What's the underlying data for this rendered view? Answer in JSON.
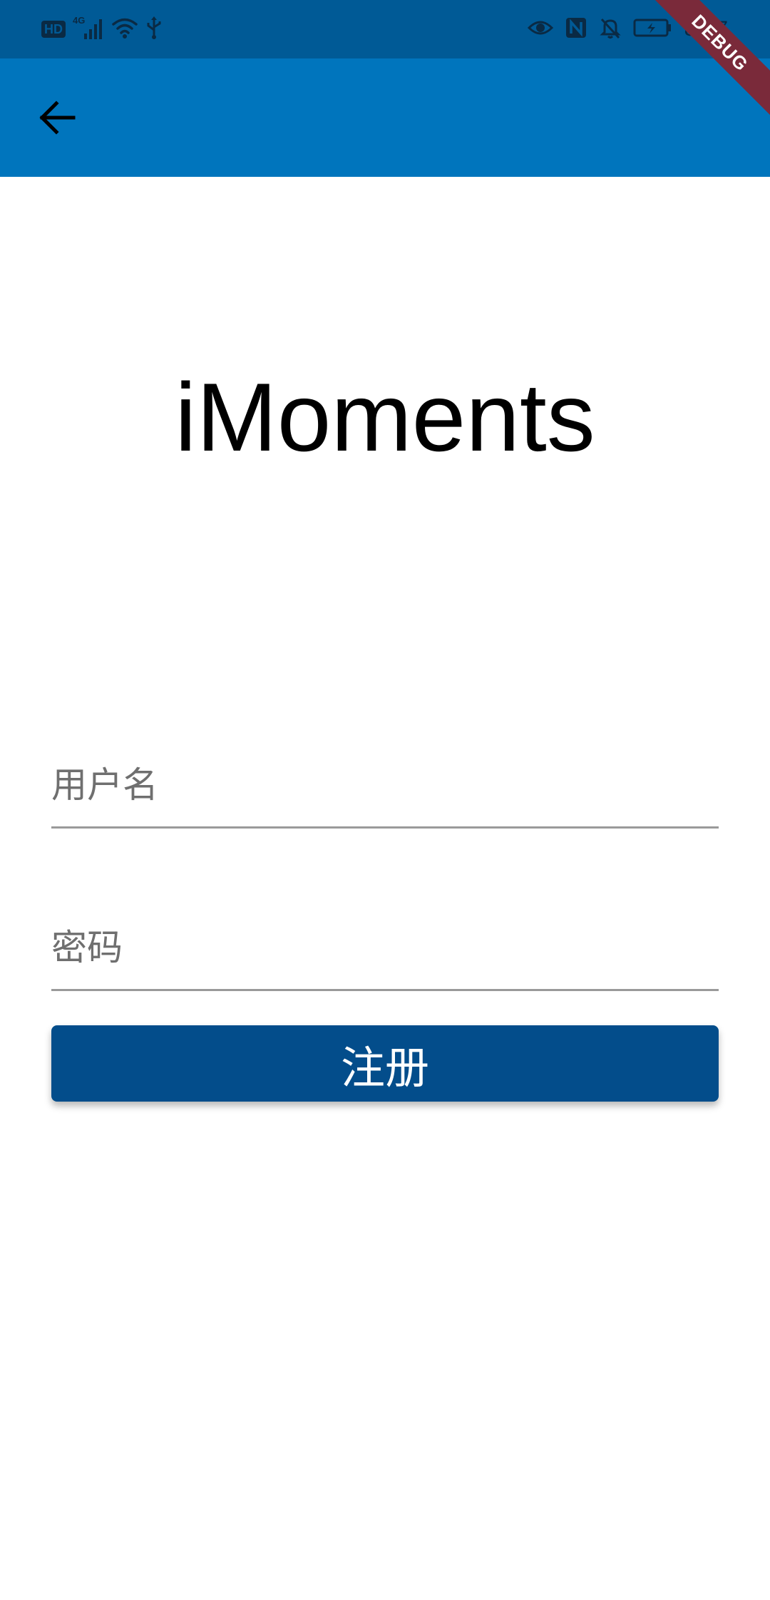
{
  "status_bar": {
    "hd_label": "HD",
    "network_label": "4G",
    "time": "8:47",
    "icons": [
      "hd-icon",
      "signal-icon",
      "wifi-icon",
      "usb-icon",
      "eye-icon",
      "nfc-icon",
      "bell-off-icon",
      "battery-icon"
    ]
  },
  "debug_banner": {
    "label": "DEBUG",
    "color": "#7a2a3a"
  },
  "app_bar": {
    "back_icon": "arrow-left-icon",
    "color": "#0075bd"
  },
  "title": "iMoments",
  "form": {
    "username": {
      "placeholder": "用户名",
      "value": ""
    },
    "password": {
      "placeholder": "密码",
      "value": ""
    },
    "register_label": "注册"
  },
  "colors": {
    "status_bar": "#005a96",
    "app_bar": "#0075bd",
    "button": "#034d8b",
    "underline": "#9a9a9a"
  }
}
